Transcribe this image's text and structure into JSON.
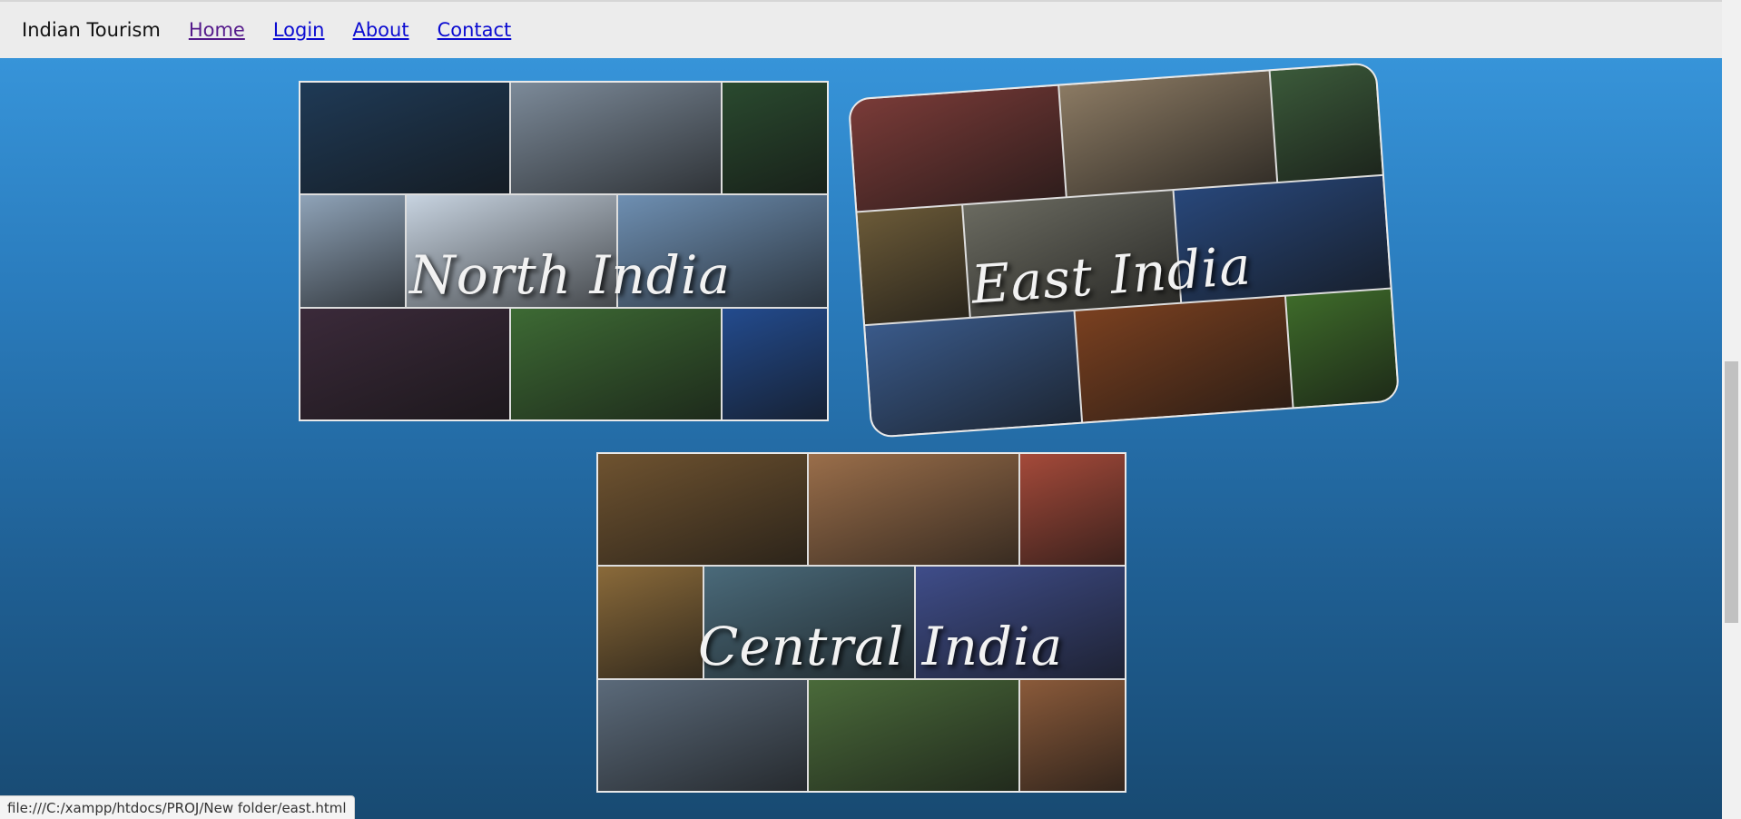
{
  "navbar": {
    "brand": "Indian Tourism",
    "links": [
      "Home",
      "Login",
      "About",
      "Contact"
    ]
  },
  "collages": [
    {
      "title": "North India",
      "tiles": [
        [
          "#1f3a56",
          "#7c8a99",
          "#2a4a2f"
        ],
        [
          "#8fa3b8",
          "#c7d3e0",
          "#6e8fb2"
        ],
        [
          "#3b2a3a",
          "#3d6a34",
          "#234b8e"
        ]
      ]
    },
    {
      "title": "East India",
      "tiles": [
        [
          "#7a3b38",
          "#8b7a63",
          "#3b5a3a"
        ],
        [
          "#6b5a38",
          "#6a6a60",
          "#28477a"
        ],
        [
          "#3a5a8a",
          "#7a4020",
          "#3e6b2a"
        ]
      ]
    },
    {
      "title": "Central India",
      "tiles": [
        [
          "#6f5330",
          "#9a6e4a",
          "#a54a3a"
        ],
        [
          "#8a6a3a",
          "#4a6a7a",
          "#3f4d8a"
        ],
        [
          "#5b6a7a",
          "#4a6a3a",
          "#8a5a3a"
        ]
      ]
    }
  ],
  "status_bar": {
    "url": "file:///C:/xampp/htdocs/PROJ/New folder/east.html"
  }
}
